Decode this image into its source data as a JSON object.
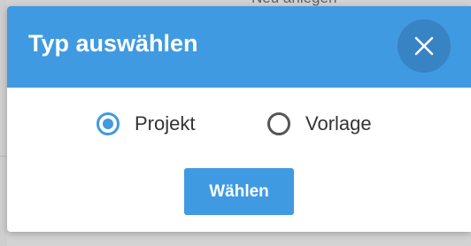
{
  "background": {
    "partial_text": "Neu anlegen"
  },
  "dialog": {
    "title": "Typ auswählen",
    "close_icon": "close-icon",
    "options": [
      {
        "label": "Projekt",
        "selected": true
      },
      {
        "label": "Vorlage",
        "selected": false
      }
    ],
    "submit_label": "Wählen"
  },
  "colors": {
    "accent": "#3f9ae1",
    "accent_dark": "#3783c3",
    "text": "#333333",
    "overlay": "#d3d3d3"
  }
}
